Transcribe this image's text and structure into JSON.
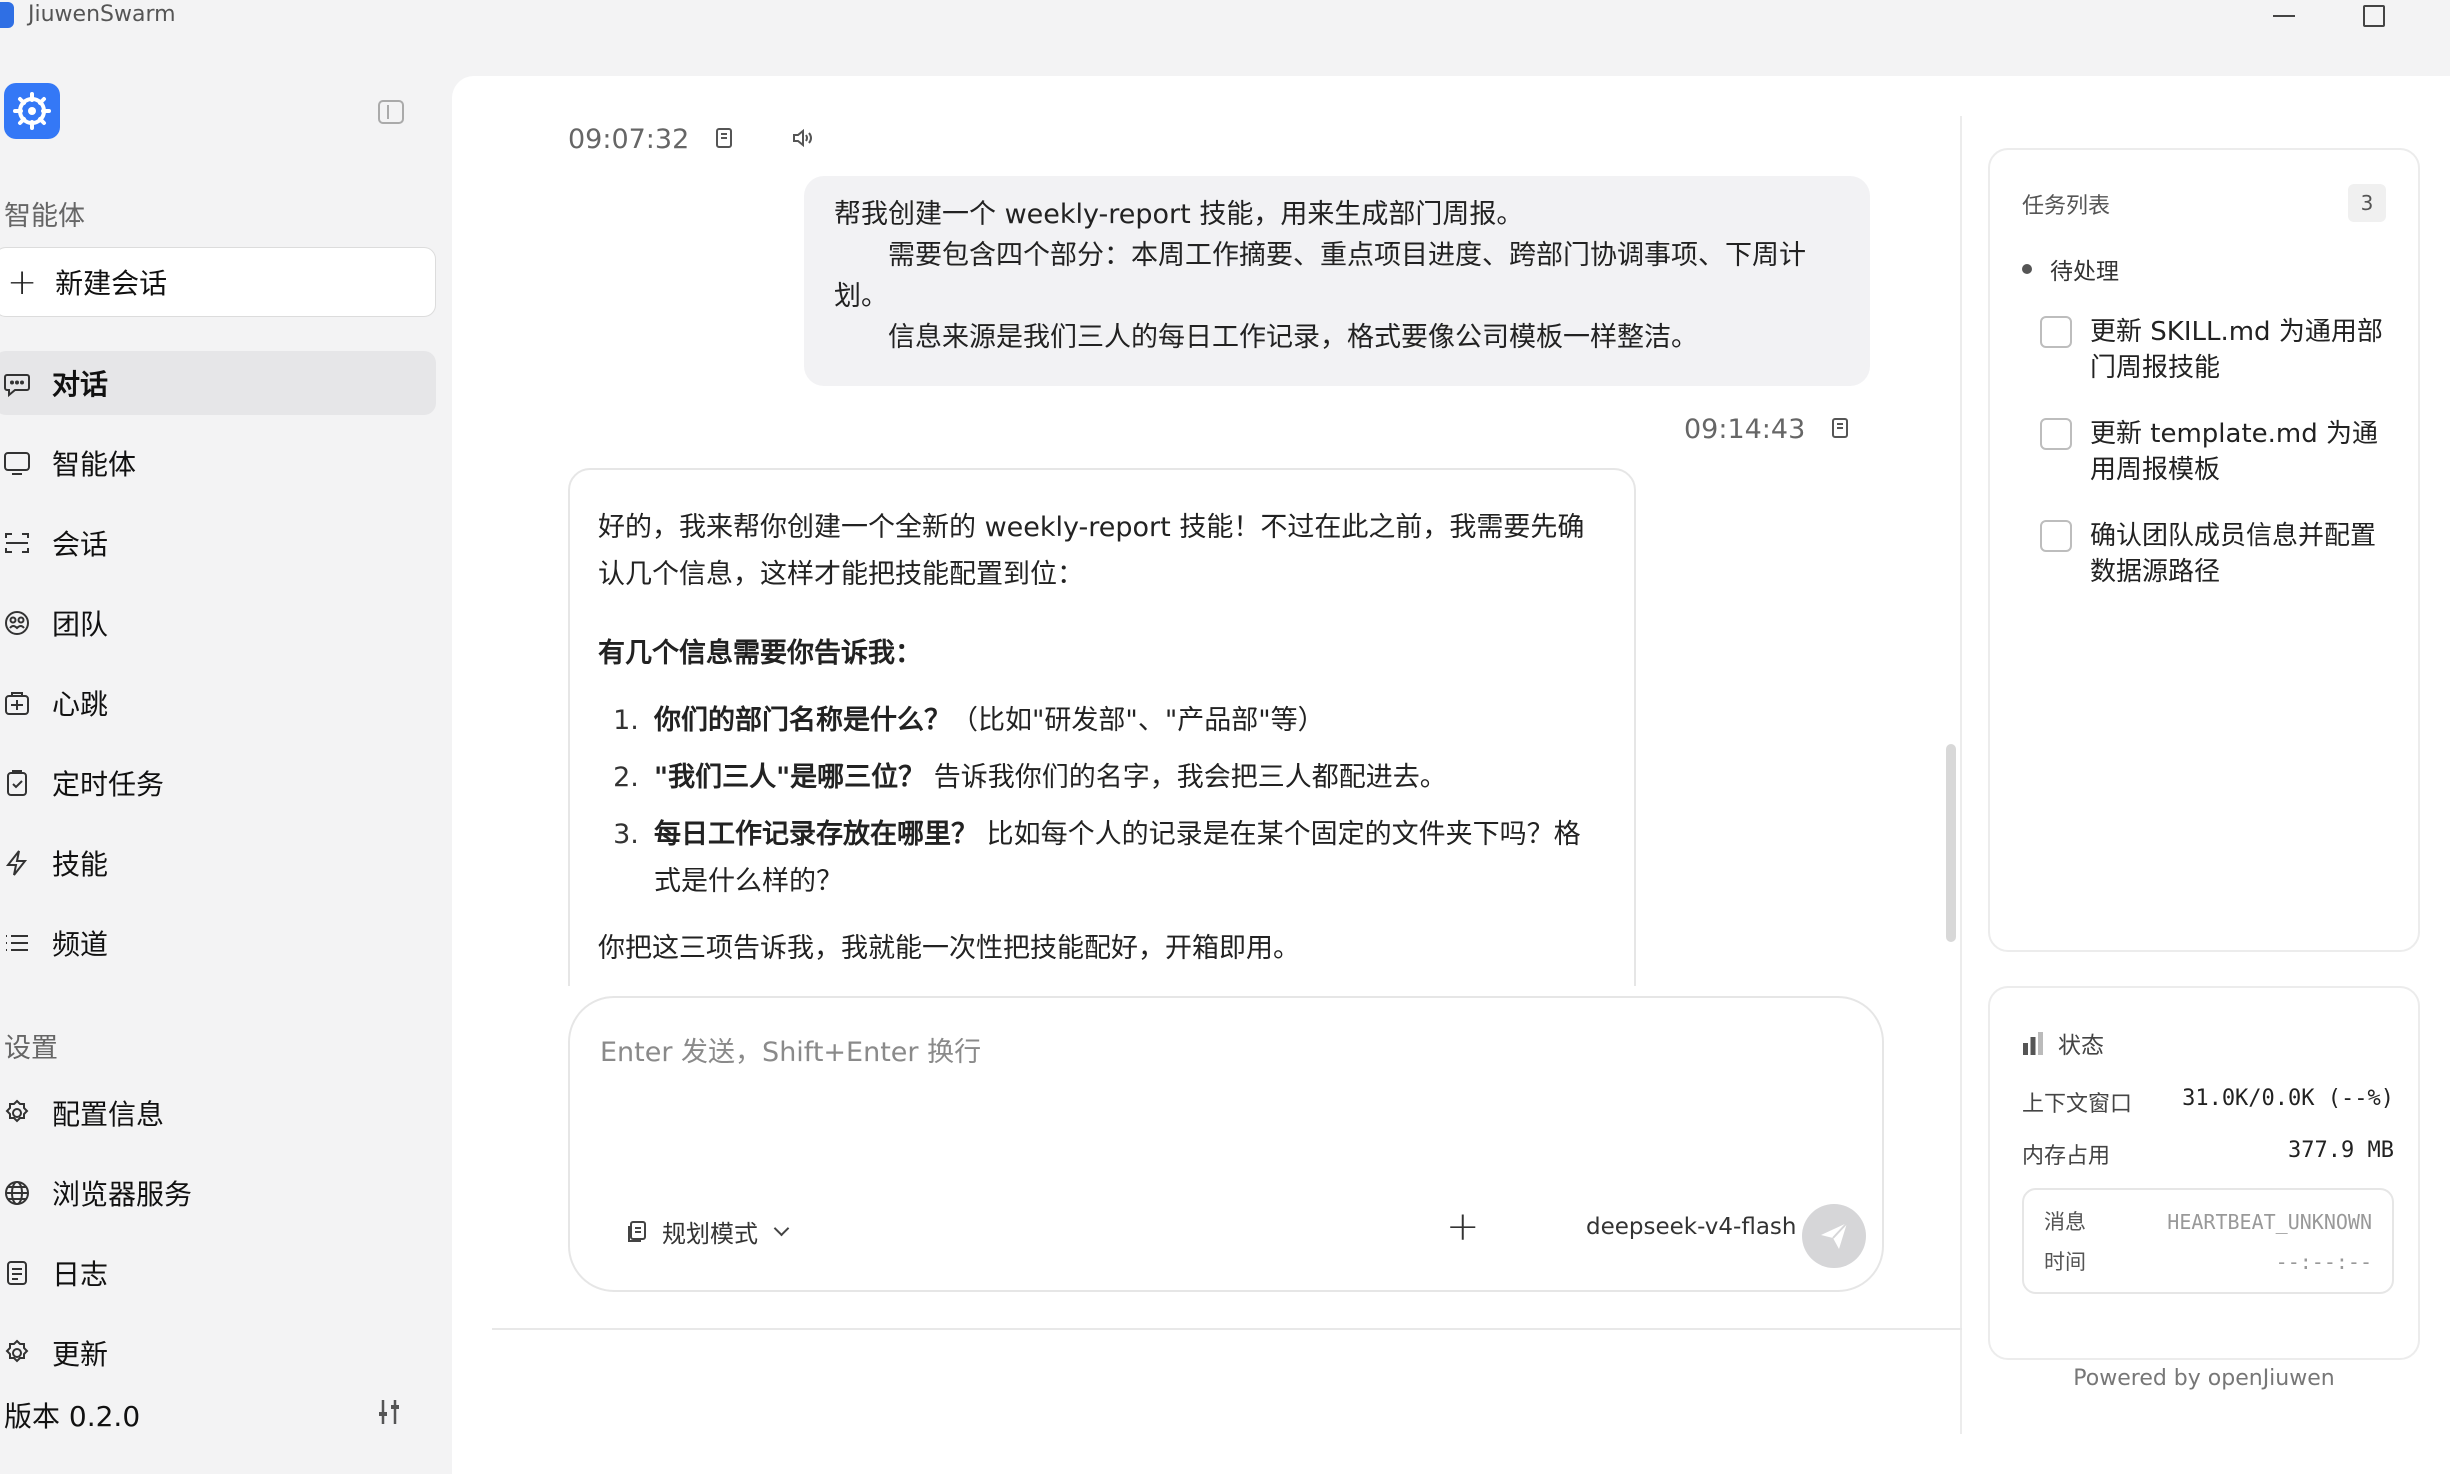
{
  "window": {
    "title": "JiuwenSwarm"
  },
  "sidebar": {
    "agents_section": "智能体",
    "new_chat": "新建会话",
    "items": [
      {
        "label": "对话",
        "icon": "chat-bubble-icon",
        "active": true
      },
      {
        "label": "智能体",
        "icon": "monitor-icon",
        "active": false
      },
      {
        "label": "会话",
        "icon": "session-icon",
        "active": false
      },
      {
        "label": "团队",
        "icon": "team-icon",
        "active": false
      },
      {
        "label": "心跳",
        "icon": "heartbeat-icon",
        "active": false
      },
      {
        "label": "定时任务",
        "icon": "clipboard-check-icon",
        "active": false
      },
      {
        "label": "技能",
        "icon": "lightning-icon",
        "active": false
      },
      {
        "label": "频道",
        "icon": "list-icon",
        "active": false
      }
    ],
    "settings_section": "设置",
    "settings_items": [
      {
        "label": "配置信息",
        "icon": "gear-icon"
      },
      {
        "label": "浏览器服务",
        "icon": "globe-icon"
      },
      {
        "label": "日志",
        "icon": "log-icon"
      },
      {
        "label": "更新",
        "icon": "gear-icon"
      }
    ],
    "version": "版本 0.2.0"
  },
  "chat": {
    "user_timestamp": "09:07:32",
    "user_message": {
      "line1": "帮我创建一个 weekly-report 技能，用来生成部门周报。",
      "line2": "　　需要包含四个部分：本周工作摘要、重点项目进度、跨部门协调事项、下周计划。",
      "line3": "　　信息来源是我们三人的每日工作记录，格式要像公司模板一样整洁。"
    },
    "ai_timestamp": "09:14:43",
    "ai_message": {
      "intro": "好的，我来帮你创建一个全新的 weekly-report 技能！不过在此之前，我需要先确认几个信息，这样才能把技能配置到位：",
      "heading": "有几个信息需要你告诉我：",
      "questions": [
        {
          "num": "1.",
          "q": "你们的部门名称是什么？",
          "detail": "（比如\"研发部\"、\"产品部\"等）"
        },
        {
          "num": "2.",
          "q": "\"我们三人\"是哪三位？",
          "detail": "告诉我你们的名字，我会把三人都配进去。"
        },
        {
          "num": "3.",
          "q": "每日工作记录存放在哪里？",
          "detail": "比如每个人的记录是在某个固定的文件夹下吗？格式是什么样的？"
        }
      ],
      "closing": "你把这三项告诉我，我就能一次性把技能配好，开箱即用。"
    }
  },
  "composer": {
    "placeholder": "Enter 发送，Shift+Enter 换行",
    "value": "",
    "mode_label": "规划模式",
    "model": "deepseek-v4-flash"
  },
  "tasks": {
    "title": "任务列表",
    "count": "3",
    "group": "待处理",
    "items": [
      {
        "label": "更新 SKILL.md 为通用部门周报技能",
        "checked": false
      },
      {
        "label": "更新 template.md 为通用周报模板",
        "checked": false
      },
      {
        "label": "确认团队成员信息并配置数据源路径",
        "checked": false
      }
    ]
  },
  "status": {
    "title": "状态",
    "context_label": "上下文窗口",
    "context_value": "31.0K/0.0K (--%)",
    "memory_label": "内存占用",
    "memory_value": "377.9 MB",
    "message_label": "消息",
    "message_value": "HEARTBEAT_UNKNOWN",
    "time_label": "时间",
    "time_value": "--:--:--"
  },
  "footer": {
    "powered_by": "Powered by openJiuwen"
  },
  "colors": {
    "accent": "#3478f6",
    "active_bg": "#e6e6e8",
    "send_disabled": "#d6d6d8"
  }
}
